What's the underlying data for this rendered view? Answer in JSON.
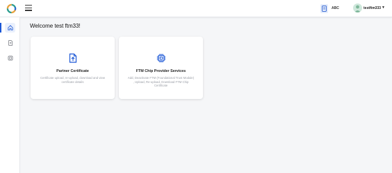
{
  "header": {
    "partner_label": "ABC",
    "user_label": "testftm333",
    "user_caret": "▼"
  },
  "sidebar": {
    "items": [
      {
        "name": "home",
        "icon": "home-icon",
        "active": true
      },
      {
        "name": "certificates",
        "icon": "document-icon",
        "active": false
      },
      {
        "name": "chip",
        "icon": "chip-icon",
        "active": false
      }
    ]
  },
  "main": {
    "welcome": "Welcome test ftm33!",
    "cards": [
      {
        "title": "Partner Certificate",
        "description": "Certificate upload, re-upload, download and view certificate details",
        "icon": "upload-file-icon"
      },
      {
        "title": "FTM Chip Provider Services",
        "description": "Add, Deactivate FTM (Foundational Trust Module) , Upload, Re-upload, Download FTM Chip Certificate",
        "icon": "chip-icon"
      }
    ]
  },
  "colors": {
    "accent": "#1a56d6",
    "background": "#f5f6f8"
  }
}
